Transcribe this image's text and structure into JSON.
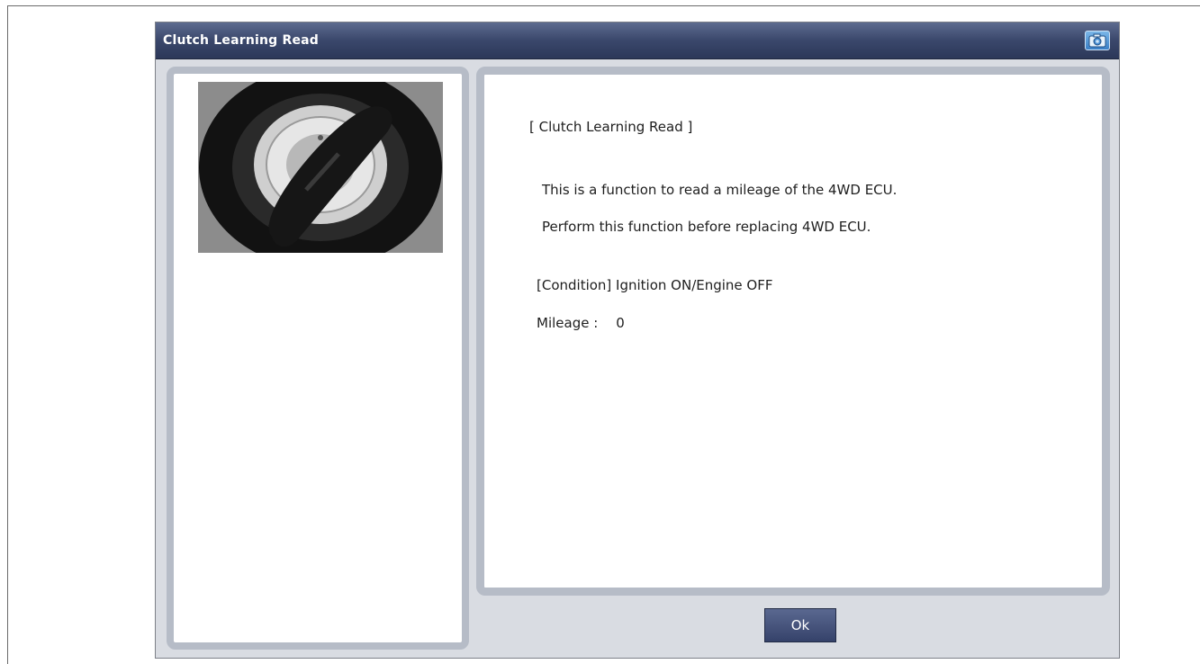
{
  "window": {
    "title": "Clutch Learning Read"
  },
  "icons": {
    "camera": "camera-icon"
  },
  "content": {
    "heading": "[ Clutch Learning Read ]",
    "description_line1": "This is a function to read a mileage of the 4WD ECU.",
    "description_line2": "Perform this function before replacing 4WD ECU.",
    "condition": "[Condition] Ignition ON/Engine OFF",
    "mileage_label": "Mileage :",
    "mileage_value": "0"
  },
  "buttons": {
    "ok_label": "Ok"
  },
  "colors": {
    "title_bar": "#3a476b",
    "panel_border": "#b6bcc7",
    "button": "#35426a",
    "background": "#d9dce2"
  }
}
